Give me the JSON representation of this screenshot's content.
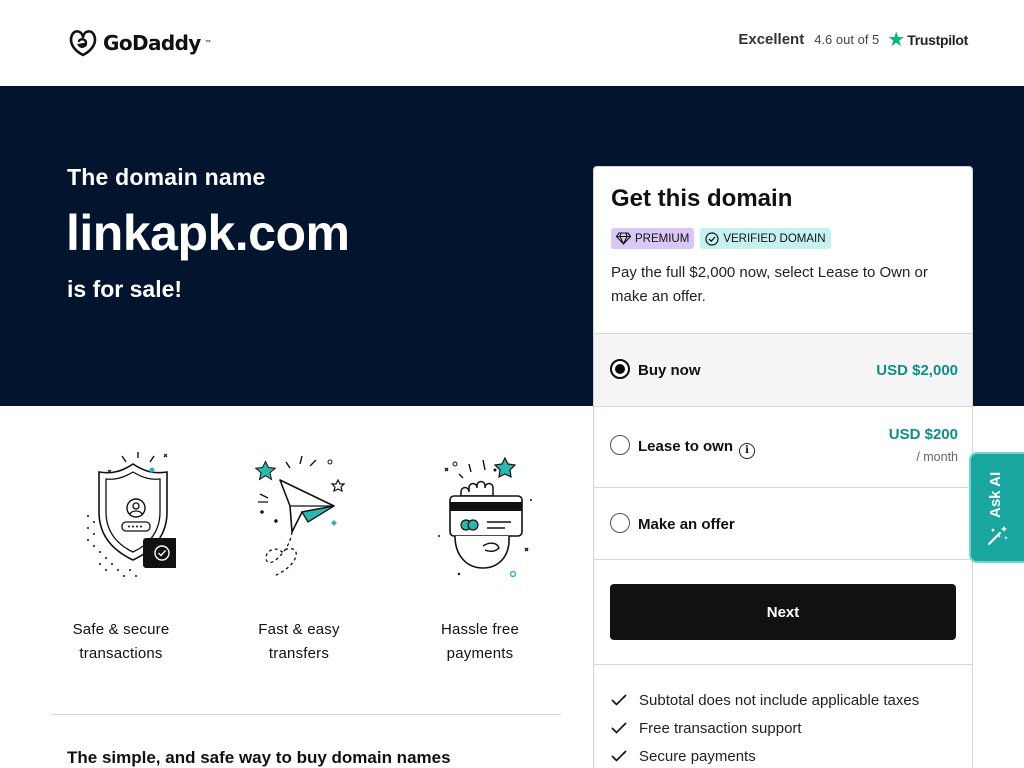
{
  "header": {
    "logo_text": "GoDaddy",
    "trustpilot": {
      "rating_word": "Excellent",
      "rating_text": "4.6 out of 5",
      "brand": "Trustpilot"
    }
  },
  "hero": {
    "pre": "The domain name",
    "domain": "linkapk.com",
    "post": "is for sale!"
  },
  "features": [
    {
      "line1": "Safe & secure",
      "line2": "transactions",
      "icon": "shield-icon"
    },
    {
      "line1": "Fast & easy",
      "line2": "transfers",
      "icon": "paper-plane-icon"
    },
    {
      "line1": "Hassle free",
      "line2": "payments",
      "icon": "card-hand-icon"
    }
  ],
  "tagline": "The simple, and safe way to buy domain names",
  "card": {
    "title": "Get this domain",
    "badge_premium": "PREMIUM",
    "badge_verified": "VERIFIED DOMAIN",
    "description": "Pay the full $2,000 now, select Lease to Own or make an offer.",
    "options": {
      "buy": {
        "label": "Buy now",
        "price": "USD $2,000",
        "selected": true
      },
      "lease": {
        "label": "Lease to own",
        "price": "USD $200",
        "sub": "/ month",
        "selected": false
      },
      "offer": {
        "label": "Make an offer",
        "selected": false
      }
    },
    "next_label": "Next",
    "checks": [
      "Subtotal does not include applicable taxes",
      "Free transaction support",
      "Secure payments"
    ]
  },
  "ask_ai": {
    "label": "Ask AI"
  },
  "colors": {
    "hero_bg": "#02142e",
    "accent_teal": "#0a8f8a",
    "ask_ai_bg": "#1aa6a0",
    "premium_badge": "#d9c7f7",
    "verified_badge": "#c5f2ee",
    "trustpilot_green": "#00b67a"
  }
}
